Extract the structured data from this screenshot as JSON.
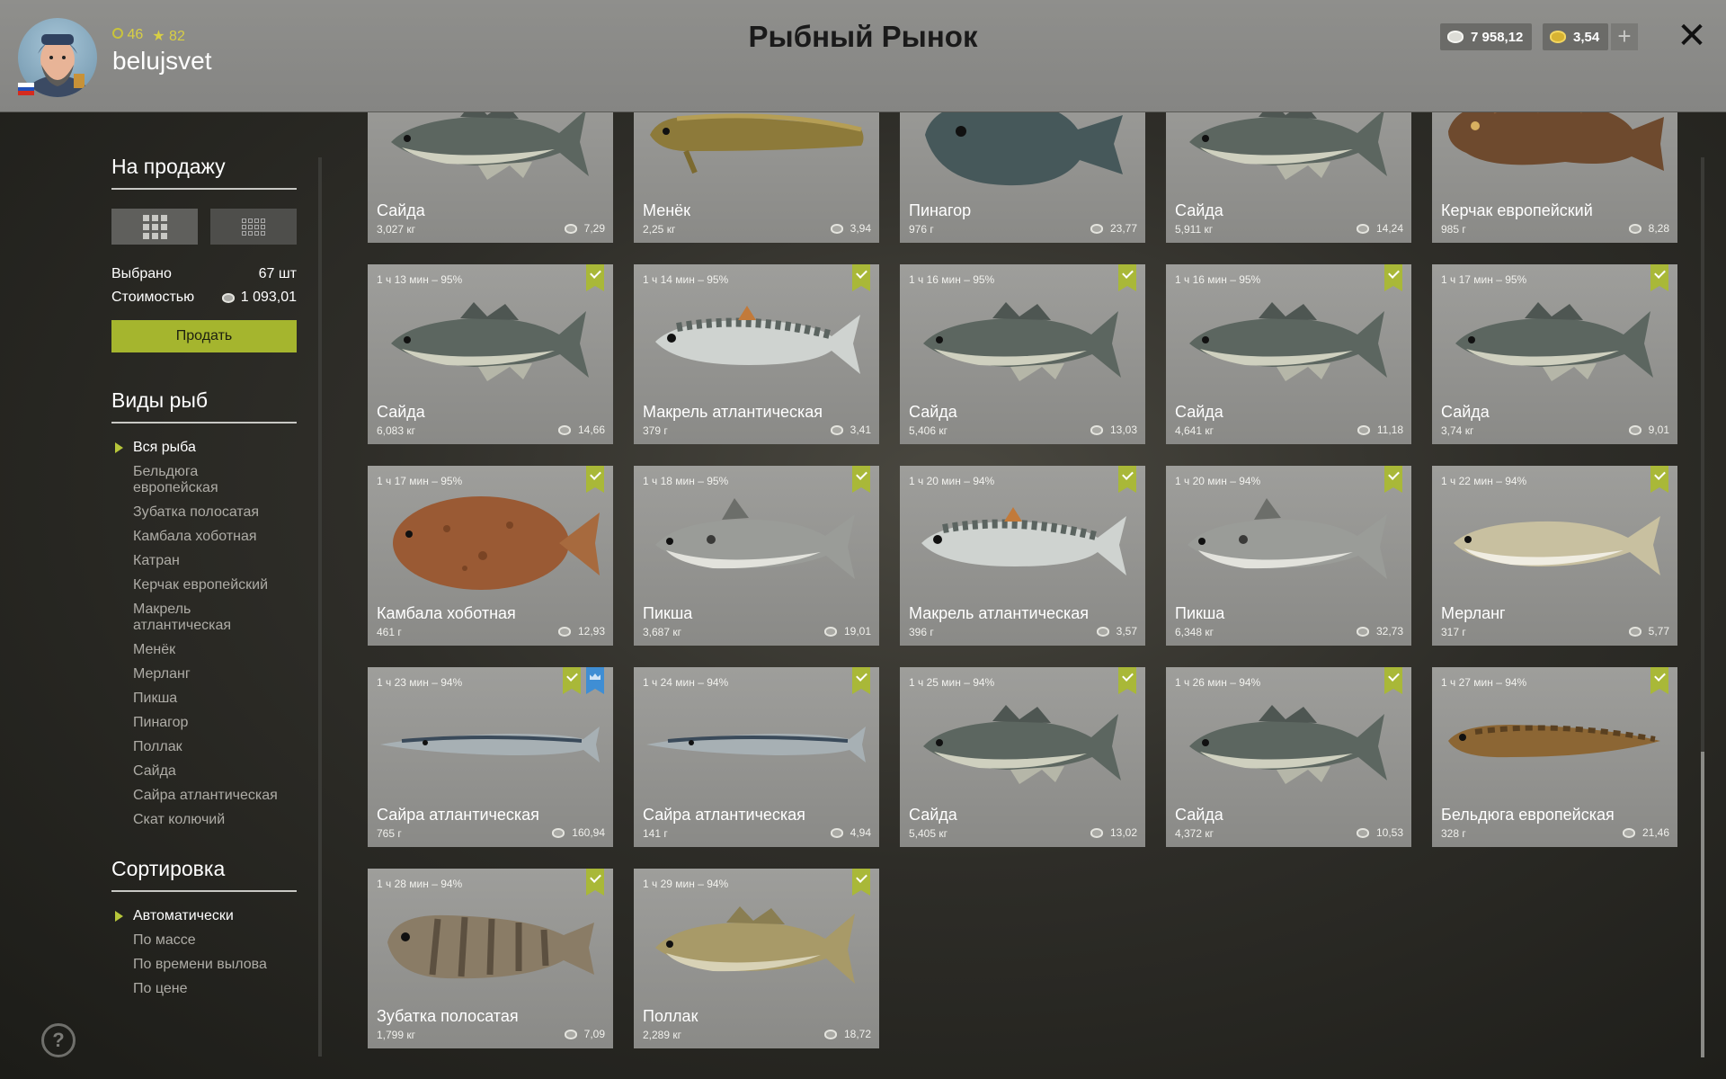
{
  "header": {
    "title": "Рыбный Рынок",
    "level": "46",
    "rank": "82",
    "username": "belujsvet",
    "silver": "7 958,12",
    "gold": "3,54",
    "plus": "+",
    "close": "✕"
  },
  "sidebar": {
    "for_sale": "На продажу",
    "selected_label": "Выбрано",
    "selected_value": "67 шт",
    "cost_label": "Стоимостью",
    "cost_value": "1 093,01",
    "sell": "Продать",
    "species_title": "Виды рыб",
    "species": [
      "Вся рыба",
      "Бельдюга европейская",
      "Зубатка полосатая",
      "Камбала хоботная",
      "Катран",
      "Керчак европейский",
      "Макрель атлантическая",
      "Менёк",
      "Мерланг",
      "Пикша",
      "Пинагор",
      "Поллак",
      "Сайда",
      "Сайра атлантическая",
      "Скат колючий"
    ],
    "sort_title": "Сортировка",
    "sort": [
      "Автоматически",
      "По массе",
      "По времени вылова",
      "По цене"
    ],
    "help": "?"
  },
  "fish": [
    {
      "time": "",
      "name": "Сайда",
      "weight": "3,027 кг",
      "price": "7,29",
      "kind": "saithe"
    },
    {
      "time": "",
      "name": "Менёк",
      "weight": "2,25 кг",
      "price": "3,94",
      "kind": "tusk"
    },
    {
      "time": "",
      "name": "Пинагор",
      "weight": "976 г",
      "price": "23,77",
      "kind": "lump"
    },
    {
      "time": "",
      "name": "Сайда",
      "weight": "5,911 кг",
      "price": "14,24",
      "kind": "saithe"
    },
    {
      "time": "",
      "name": "Керчак европейский",
      "weight": "985 г",
      "price": "8,28",
      "kind": "sculpin"
    },
    {
      "time": "1 ч 13 мин – 95%",
      "name": "Сайда",
      "weight": "6,083 кг",
      "price": "14,66",
      "kind": "saithe"
    },
    {
      "time": "1 ч 14 мин – 95%",
      "name": "Макрель атлантическая",
      "weight": "379 г",
      "price": "3,41",
      "kind": "mackerel"
    },
    {
      "time": "1 ч 16 мин – 95%",
      "name": "Сайда",
      "weight": "5,406 кг",
      "price": "13,03",
      "kind": "saithe"
    },
    {
      "time": "1 ч 16 мин – 95%",
      "name": "Сайда",
      "weight": "4,641 кг",
      "price": "11,18",
      "kind": "saithe"
    },
    {
      "time": "1 ч 17 мин – 95%",
      "name": "Сайда",
      "weight": "3,74 кг",
      "price": "9,01",
      "kind": "saithe"
    },
    {
      "time": "1 ч 17 мин – 95%",
      "name": "Камбала хоботная",
      "weight": "461 г",
      "price": "12,93",
      "kind": "flounder"
    },
    {
      "time": "1 ч 18 мин – 95%",
      "name": "Пикша",
      "weight": "3,687 кг",
      "price": "19,01",
      "kind": "haddock"
    },
    {
      "time": "1 ч 20 мин – 94%",
      "name": "Макрель атлантическая",
      "weight": "396 г",
      "price": "3,57",
      "kind": "mackerel"
    },
    {
      "time": "1 ч 20 мин – 94%",
      "name": "Пикша",
      "weight": "6,348 кг",
      "price": "32,73",
      "kind": "haddock"
    },
    {
      "time": "1 ч 22 мин – 94%",
      "name": "Мерланг",
      "weight": "317 г",
      "price": "5,77",
      "kind": "whiting"
    },
    {
      "time": "1 ч 23 мин – 94%",
      "name": "Сайра атлантическая",
      "weight": "765 г",
      "price": "160,94",
      "kind": "saury",
      "trophy": true
    },
    {
      "time": "1 ч 24 мин – 94%",
      "name": "Сайра атлантическая",
      "weight": "141 г",
      "price": "4,94",
      "kind": "saury"
    },
    {
      "time": "1 ч 25 мин – 94%",
      "name": "Сайда",
      "weight": "5,405 кг",
      "price": "13,02",
      "kind": "saithe"
    },
    {
      "time": "1 ч 26 мин – 94%",
      "name": "Сайда",
      "weight": "4,372 кг",
      "price": "10,53",
      "kind": "saithe"
    },
    {
      "time": "1 ч 27 мин – 94%",
      "name": "Бельдюга европейская",
      "weight": "328 г",
      "price": "21,46",
      "kind": "eelpout"
    },
    {
      "time": "1 ч 28 мин – 94%",
      "name": "Зубатка полосатая",
      "weight": "1,799 кг",
      "price": "7,09",
      "kind": "wolffish"
    },
    {
      "time": "1 ч 29 мин – 94%",
      "name": "Поллак",
      "weight": "2,289 кг",
      "price": "18,72",
      "kind": "pollack"
    }
  ]
}
